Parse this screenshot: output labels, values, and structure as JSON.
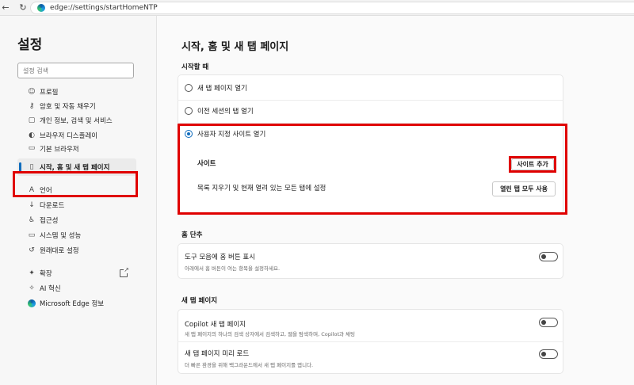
{
  "browser": {
    "url": "edge://settings/startHomeNTP"
  },
  "sidebar": {
    "title": "설정",
    "search_placeholder": "설정 검색",
    "items": [
      {
        "label": "프로필",
        "icon": "profile-icon"
      },
      {
        "label": "암호 및 자동 채우기",
        "icon": "key-icon"
      },
      {
        "label": "개인 정보, 검색 및 서비스",
        "icon": "lock-icon"
      },
      {
        "label": "브라우저 디스플레이",
        "icon": "palette-icon"
      },
      {
        "label": "기본 브라우저",
        "icon": "browser-icon"
      },
      {
        "label": "시작, 홈 및 새 탭 페이지",
        "icon": "home-page-icon"
      },
      {
        "label": "언어",
        "icon": "language-icon"
      },
      {
        "label": "다운로드",
        "icon": "download-icon"
      },
      {
        "label": "접근성",
        "icon": "accessibility-icon"
      },
      {
        "label": "시스템 및 성능",
        "icon": "laptop-icon"
      },
      {
        "label": "원래대로 설정",
        "icon": "reset-icon"
      },
      {
        "label": "확장",
        "icon": "puzzle-icon"
      },
      {
        "label": "AI 혁신",
        "icon": "ai-icon"
      },
      {
        "label": "Microsoft Edge 정보",
        "icon": "edge-icon"
      }
    ]
  },
  "main": {
    "title": "시작, 홈 및 새 탭 페이지",
    "startup": {
      "heading": "시작할 때",
      "opt_new_tab": "새 탭 페이지 열기",
      "opt_previous": "이전 세션의 탭 열기",
      "opt_custom": "사용자 지정 사이트 열기",
      "sites_label": "사이트",
      "add_site_button": "사이트 추가",
      "clear_label": "목록 지우기 및 현재 열려 있는 모든 탭에 설정",
      "use_open_tabs_button": "열린 탭 모두 사용"
    },
    "home": {
      "heading": "홈 단추",
      "show_home_label": "도구 모음에 홈 버튼 표시",
      "show_home_desc": "아래에서 홈 버튼이 여는 항목을 설정하세요."
    },
    "new_tab": {
      "heading": "새 탭 페이지",
      "copilot_label": "Copilot 새 탭 페이지",
      "copilot_desc": "새 탭 페이지의 하나의 검색 상자에서 검색하고, 웹을 탐색하며, Copilot과 채팅",
      "preload_label": "새 탭 페이지 미리 로드",
      "preload_desc": "더 빠른 환경을 위해 백그라운드에서 새 탭 페이지를 엽니다."
    }
  },
  "colors": {
    "highlight": "#e00000",
    "accent": "#0f6cbd"
  }
}
